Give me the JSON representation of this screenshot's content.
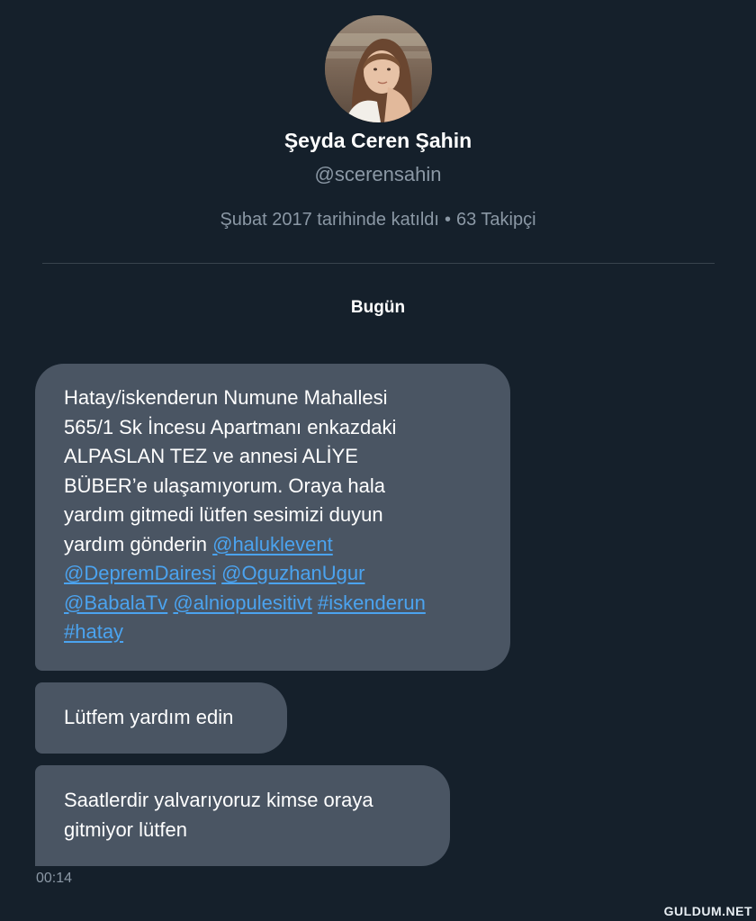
{
  "profile": {
    "name": "Şeyda Ceren Şahin",
    "handle": "@scerensahin",
    "joined": "Şubat 2017 tarihinde katıldı",
    "separator": "•",
    "followers": "63 Takipçi"
  },
  "conversation": {
    "day_label": "Bugün",
    "messages": [
      {
        "lines": [
          "Hatay/iskenderun Numune Mahallesi",
          "565/1 Sk İncesu Apartmanı enkazdaki",
          "ALPASLAN TEZ ve annesi ALİYE",
          "BÜBER’e ulaşamıyorum. Oraya hala",
          "yardım gitmedi lütfen sesimizi duyun",
          "yardım gönderin"
        ],
        "links": [
          "@haluklevent",
          "@DepremDairesi",
          "@OguzhanUgur",
          "@BabalaTv",
          "@alniopulesitivt",
          "#iskenderun",
          "#hatay"
        ]
      },
      {
        "lines": [
          "Lütfem yardım edin"
        ]
      },
      {
        "lines": [
          "Saatlerdir yalvarıyoruz kimse oraya",
          "gitmiyor lütfen"
        ]
      }
    ],
    "timestamp": "00:14"
  },
  "watermark": "GULDUM.NET",
  "colors": {
    "background": "#15202b",
    "bubble": "#4a5563",
    "link": "#4ba3ef",
    "secondary_text": "#8b98a5"
  }
}
